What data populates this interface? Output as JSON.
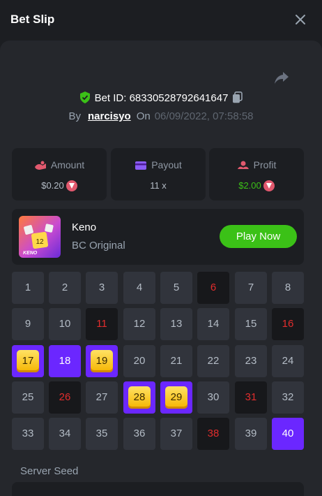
{
  "header": {
    "title": "Bet Slip"
  },
  "bet": {
    "id_label": "Bet ID:",
    "id": "68330528792641647",
    "by_label": "By",
    "username": "narcisyo",
    "on_label": "On",
    "datetime": "06/09/2022, 07:58:58"
  },
  "stats": {
    "amount": {
      "label": "Amount",
      "value": "$0.20",
      "icon": "wallet-icon"
    },
    "payout": {
      "label": "Payout",
      "value": "11 x",
      "icon": "card-icon"
    },
    "profit": {
      "label": "Profit",
      "value": "$2.00",
      "icon": "profit-icon"
    }
  },
  "game": {
    "name": "Keno",
    "subtitle": "BC Original",
    "thumb_text": "KENO",
    "thumb_tile": "12",
    "play_label": "Play Now"
  },
  "grid": {
    "cells": [
      {
        "n": "1",
        "state": "normal"
      },
      {
        "n": "2",
        "state": "normal"
      },
      {
        "n": "3",
        "state": "normal"
      },
      {
        "n": "4",
        "state": "normal"
      },
      {
        "n": "5",
        "state": "normal"
      },
      {
        "n": "6",
        "state": "miss"
      },
      {
        "n": "7",
        "state": "normal"
      },
      {
        "n": "8",
        "state": "normal"
      },
      {
        "n": "9",
        "state": "normal"
      },
      {
        "n": "10",
        "state": "normal"
      },
      {
        "n": "11",
        "state": "miss"
      },
      {
        "n": "12",
        "state": "normal"
      },
      {
        "n": "13",
        "state": "normal"
      },
      {
        "n": "14",
        "state": "normal"
      },
      {
        "n": "15",
        "state": "normal"
      },
      {
        "n": "16",
        "state": "miss"
      },
      {
        "n": "17",
        "state": "hit"
      },
      {
        "n": "18",
        "state": "pick"
      },
      {
        "n": "19",
        "state": "hit"
      },
      {
        "n": "20",
        "state": "normal"
      },
      {
        "n": "21",
        "state": "normal"
      },
      {
        "n": "22",
        "state": "normal"
      },
      {
        "n": "23",
        "state": "normal"
      },
      {
        "n": "24",
        "state": "normal"
      },
      {
        "n": "25",
        "state": "normal"
      },
      {
        "n": "26",
        "state": "miss"
      },
      {
        "n": "27",
        "state": "normal"
      },
      {
        "n": "28",
        "state": "hit"
      },
      {
        "n": "29",
        "state": "hit"
      },
      {
        "n": "30",
        "state": "normal"
      },
      {
        "n": "31",
        "state": "miss"
      },
      {
        "n": "32",
        "state": "normal"
      },
      {
        "n": "33",
        "state": "normal"
      },
      {
        "n": "34",
        "state": "normal"
      },
      {
        "n": "35",
        "state": "normal"
      },
      {
        "n": "36",
        "state": "normal"
      },
      {
        "n": "37",
        "state": "normal"
      },
      {
        "n": "38",
        "state": "miss"
      },
      {
        "n": "39",
        "state": "normal"
      },
      {
        "n": "40",
        "state": "pick"
      }
    ]
  },
  "seed": {
    "label": "Server Seed"
  },
  "colors": {
    "accent_green": "#3bc117",
    "pick_purple": "#6b27ff",
    "miss_red": "#e12d2d",
    "gem_yellow": "#f5b400"
  }
}
